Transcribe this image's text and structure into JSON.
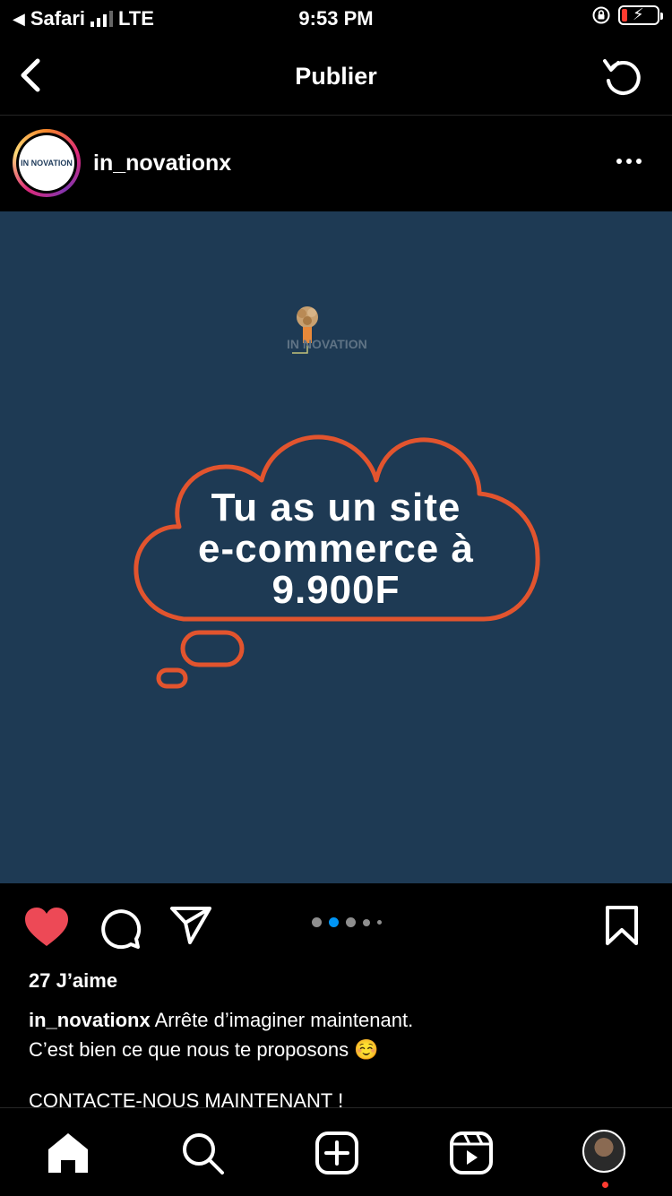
{
  "status_bar": {
    "back_app": "Safari",
    "network": "LTE",
    "time": "9:53 PM"
  },
  "nav": {
    "title": "Publier"
  },
  "post": {
    "username": "in_novationx",
    "avatar_text": "IN NOVATION",
    "media": {
      "logo_text": "IN NOVATION",
      "headline_lines": [
        "Tu as un site",
        "e-commerce à",
        "9.900F"
      ],
      "background_color": "#1e3a54",
      "accent_color": "#e2542e"
    },
    "likes": "27 J’aime",
    "caption": {
      "author": "in_novationx",
      "line1": "Arrête d’imaginer maintenant.",
      "line2": "C’est bien ce que nous te proposons ☺️",
      "line3": "CONTACTE-NOUS MAINTENANT !"
    },
    "carousel": {
      "total_dots": 5,
      "active_index": 1
    },
    "liked": true
  },
  "tabbar": {
    "items": [
      "home-icon",
      "search-icon",
      "create-icon",
      "reels-icon",
      "profile"
    ]
  },
  "colors": {
    "like_red": "#ed4956",
    "active_dot": "#0095f6",
    "notif_red": "#ff3b30"
  }
}
